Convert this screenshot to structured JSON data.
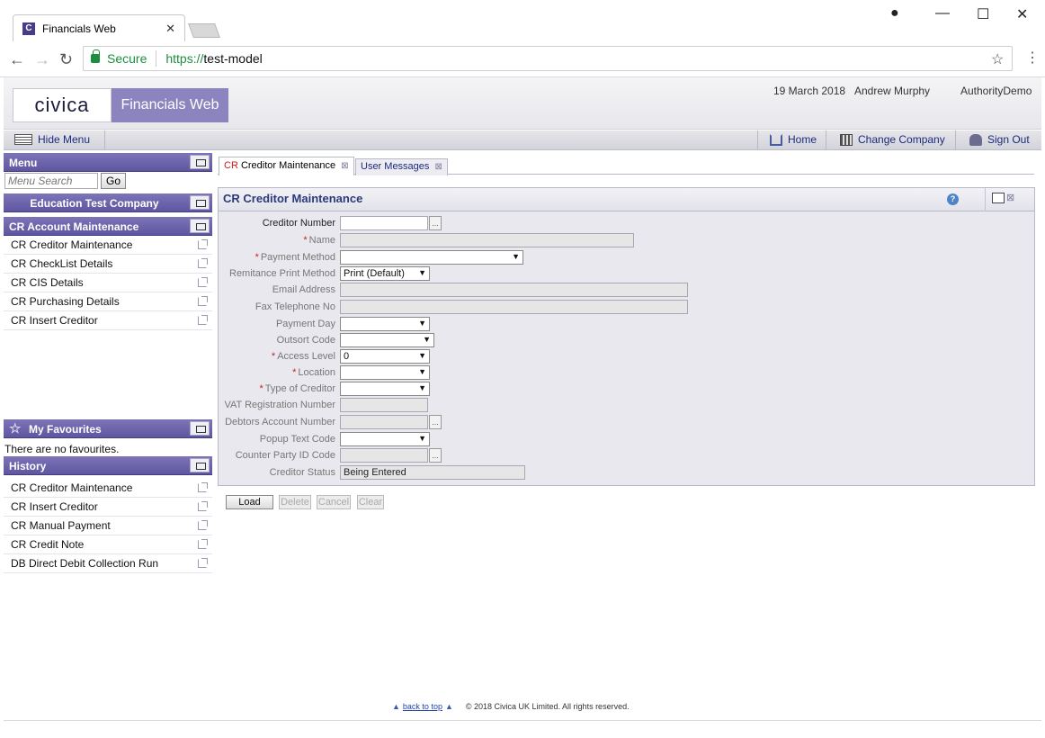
{
  "browser": {
    "tab_title": "Financials Web",
    "tab_favicon": "C",
    "secure_label": "Secure",
    "url_proto": "https://",
    "url_host": "test-model"
  },
  "header": {
    "logo": "civica",
    "product": "Financials Web",
    "date": "19 March 2018",
    "user": "Andrew Murphy",
    "authority": "AuthorityDemo"
  },
  "menubar": {
    "hide_menu": "Hide Menu",
    "home": "Home",
    "change_company": "Change Company",
    "sign_out": "Sign Out"
  },
  "sidebar": {
    "menu_title": "Menu",
    "search_placeholder": "Menu Search",
    "go_label": "Go",
    "company": "Education Test Company",
    "section": "CR Account Maintenance",
    "items": [
      {
        "label": "CR Creditor Maintenance"
      },
      {
        "label": "CR CheckList Details"
      },
      {
        "label": "CR CIS Details"
      },
      {
        "label": "CR Purchasing Details"
      },
      {
        "label": "CR Insert Creditor"
      }
    ],
    "favourites_title": "My Favourites",
    "no_favourites": "There are no favourites.",
    "history_title": "History",
    "history": [
      {
        "label": "CR Creditor Maintenance"
      },
      {
        "label": "CR Insert Creditor"
      },
      {
        "label": "CR Manual Payment"
      },
      {
        "label": "CR Credit Note"
      },
      {
        "label": "DB Direct Debit Collection Run"
      }
    ]
  },
  "content_tabs": [
    {
      "prefix": "CR",
      "label": "Creditor Maintenance"
    },
    {
      "label": "User Messages"
    }
  ],
  "form": {
    "title": "CR Creditor Maintenance",
    "fields": {
      "creditor_number": {
        "label": "Creditor Number",
        "value": ""
      },
      "name": {
        "label": "Name",
        "value": ""
      },
      "payment_method": {
        "label": "Payment Method",
        "value": ""
      },
      "remittance_print_method": {
        "label": "Remitance Print Method",
        "value": "Print (Default)"
      },
      "email_address": {
        "label": "Email Address",
        "value": ""
      },
      "fax_telephone_no": {
        "label": "Fax Telephone No",
        "value": ""
      },
      "payment_day": {
        "label": "Payment Day",
        "value": ""
      },
      "outsort_code": {
        "label": "Outsort Code",
        "value": ""
      },
      "access_level": {
        "label": "Access Level",
        "value": "0"
      },
      "location": {
        "label": "Location",
        "value": ""
      },
      "type_of_creditor": {
        "label": "Type of Creditor",
        "value": ""
      },
      "vat_registration_number": {
        "label": "VAT Registration Number",
        "value": ""
      },
      "debtors_account_number": {
        "label": "Debtors Account Number",
        "value": ""
      },
      "popup_text_code": {
        "label": "Popup Text Code",
        "value": ""
      },
      "counter_party_id_code": {
        "label": "Counter Party ID Code",
        "value": ""
      },
      "creditor_status": {
        "label": "Creditor Status",
        "value": "Being Entered"
      }
    },
    "required_marker": "*",
    "lookup_label": "...",
    "buttons": {
      "load": "Load",
      "delete": "Delete",
      "cancel": "Cancel",
      "clear": "Clear"
    }
  },
  "footer": {
    "back_to_top": "back to top",
    "copyright": "© 2018 Civica UK Limited. All rights reserved."
  }
}
